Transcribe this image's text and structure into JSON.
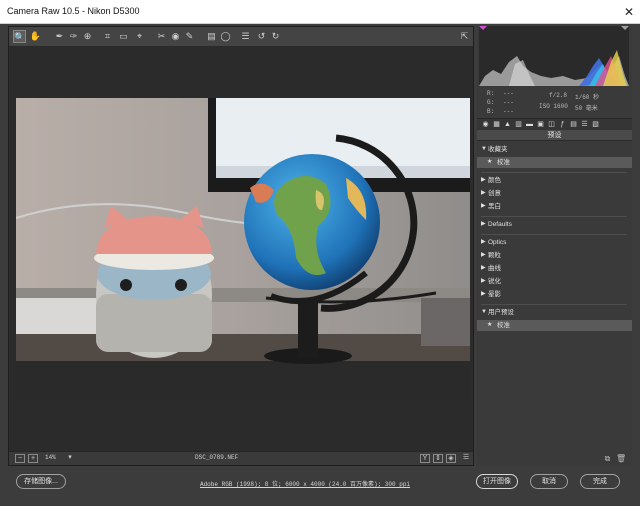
{
  "window": {
    "title": "Camera Raw 10.5 - Nikon D5300"
  },
  "toolbar": {
    "tools": [
      {
        "name": "zoom-tool-icon",
        "glyph": "🔍",
        "active": true
      },
      {
        "name": "hand-tool-icon",
        "glyph": "✋"
      },
      {
        "name": "white-balance-tool-icon",
        "glyph": "✒"
      },
      {
        "name": "color-sampler-tool-icon",
        "glyph": "✑"
      },
      {
        "name": "targeted-adjustment-tool-icon",
        "glyph": "⊕"
      },
      {
        "name": "crop-tool-icon",
        "glyph": "⌗"
      },
      {
        "name": "straighten-tool-icon",
        "glyph": "▭"
      },
      {
        "name": "transform-tool-icon",
        "glyph": "⌖"
      },
      {
        "name": "spot-removal-tool-icon",
        "glyph": "✂"
      },
      {
        "name": "red-eye-tool-icon",
        "glyph": "◉"
      },
      {
        "name": "adjustment-brush-icon",
        "glyph": "✎"
      },
      {
        "name": "graduated-filter-icon",
        "glyph": "▤"
      },
      {
        "name": "radial-filter-icon",
        "glyph": "◯"
      },
      {
        "name": "preferences-icon",
        "glyph": "☰"
      },
      {
        "name": "rotate-left-icon",
        "glyph": "↺"
      },
      {
        "name": "rotate-right-icon",
        "glyph": "↻"
      }
    ],
    "fullscreen_glyph": "⇱"
  },
  "bottombar": {
    "zoom_out": "−",
    "zoom_in": "+",
    "zoom_level": "14%",
    "zoom_dropdown": "▾",
    "filename": "DSC_0789.NEF",
    "view_y": "Y",
    "view_b": "⇕",
    "view_c": "◈",
    "view_d": "☰"
  },
  "info": {
    "r_label": "R:",
    "r_val": "---",
    "g_label": "G:",
    "g_val": "---",
    "b_label": "B:",
    "b_val": "---",
    "aperture": "f/2.8",
    "shutter": "1/60 秒",
    "iso": "ISO 1600",
    "focal": "50 毫米"
  },
  "panel": {
    "section_title": "预设",
    "rows": [
      {
        "type": "group",
        "arrow": "▼",
        "label": "收藏夹"
      },
      {
        "type": "sub",
        "arrow": "★",
        "label": "校准"
      },
      {
        "type": "sep"
      },
      {
        "type": "group",
        "arrow": "▶",
        "label": "颜色"
      },
      {
        "type": "group",
        "arrow": "▶",
        "label": "创意"
      },
      {
        "type": "group",
        "arrow": "▶",
        "label": "黑白"
      },
      {
        "type": "sep"
      },
      {
        "type": "group",
        "arrow": "▶",
        "label": "Defaults"
      },
      {
        "type": "sep"
      },
      {
        "type": "group",
        "arrow": "▶",
        "label": "Optics"
      },
      {
        "type": "group",
        "arrow": "▶",
        "label": "颗粒"
      },
      {
        "type": "group",
        "arrow": "▶",
        "label": "曲线"
      },
      {
        "type": "group",
        "arrow": "▶",
        "label": "锐化"
      },
      {
        "type": "group",
        "arrow": "▶",
        "label": "晕影"
      },
      {
        "type": "sep"
      },
      {
        "type": "group",
        "arrow": "▼",
        "label": "用户预设"
      },
      {
        "type": "sub",
        "arrow": "★",
        "label": "校准"
      }
    ]
  },
  "footer": {
    "save_label": "存储图像...",
    "workflow_link": "Adobe RGB (1998); 8 位; 6000 x 4000 (24.0 百万像素); 300 ppi",
    "open_label": "打开图像",
    "cancel_label": "取消",
    "done_label": "完成"
  }
}
